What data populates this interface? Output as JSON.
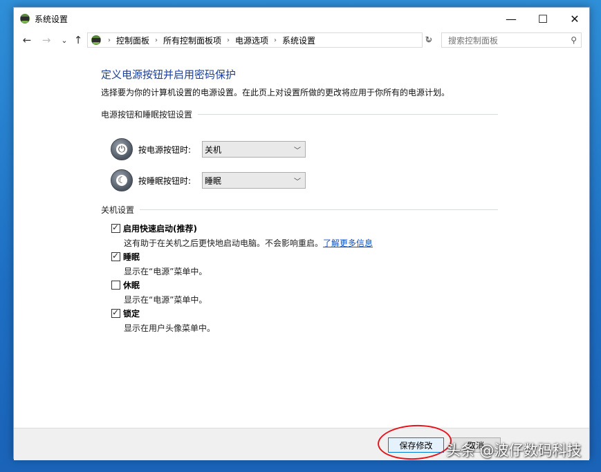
{
  "window": {
    "title": "系统设置",
    "minimize": "—",
    "maximize": "☐",
    "close": "✕"
  },
  "nav": {
    "back": "←",
    "forward": "→",
    "recent": "⌄",
    "up": "↑",
    "breadcrumb": [
      "控制面板",
      "所有控制面板项",
      "电源选项",
      "系统设置"
    ],
    "separator": "›",
    "address_dropdown": "⌄",
    "refresh": "↻",
    "search_placeholder": "搜索控制面板",
    "search_icon": "⚲"
  },
  "main": {
    "title": "定义电源按钮并启用密码保护",
    "description": "选择要为你的计算机设置的电源设置。在此页上对设置所做的更改将应用于你所有的电源计划。",
    "power_section": {
      "header": "电源按钮和睡眠按钮设置",
      "power_button": {
        "label": "按电源按钮时:",
        "value": "关机",
        "icon": "power-icon"
      },
      "sleep_button": {
        "label": "按睡眠按钮时:",
        "value": "睡眠",
        "icon": "sleep-moon-icon"
      }
    },
    "shutdown_section": {
      "header": "关机设置",
      "items": [
        {
          "label": "启用快速启动(推荐)",
          "checked": true,
          "desc": "这有助于在关机之后更快地启动电脑。不会影响重启。",
          "link": "了解更多信息"
        },
        {
          "label": "睡眠",
          "checked": true,
          "desc": "显示在“电源”菜单中。"
        },
        {
          "label": "休眠",
          "checked": false,
          "desc": "显示在“电源”菜单中。"
        },
        {
          "label": "锁定",
          "checked": true,
          "desc": "显示在用户头像菜单中。"
        }
      ]
    }
  },
  "footer": {
    "save": "保存修改",
    "cancel": "取消"
  },
  "watermark": "头条 @波仔数码科技"
}
